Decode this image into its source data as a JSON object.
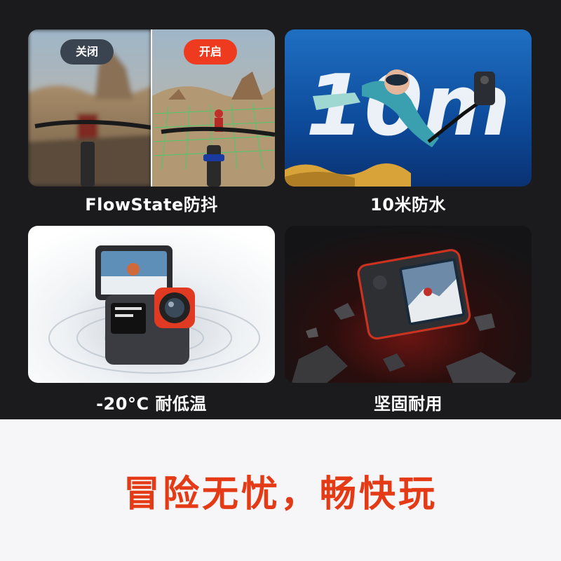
{
  "features": [
    {
      "caption": "FlowState防抖",
      "toggle_off": "关闭",
      "toggle_on": "开启"
    },
    {
      "caption": "10米防水",
      "overlay_text": "10m"
    },
    {
      "caption": "-20°C 耐低温"
    },
    {
      "caption": "坚固耐用"
    }
  ],
  "slogan": "冒险无忧，畅快玩",
  "colors": {
    "accent": "#e53a16",
    "dark_bg": "#1b1b1d",
    "light_bg": "#f6f6f8"
  }
}
